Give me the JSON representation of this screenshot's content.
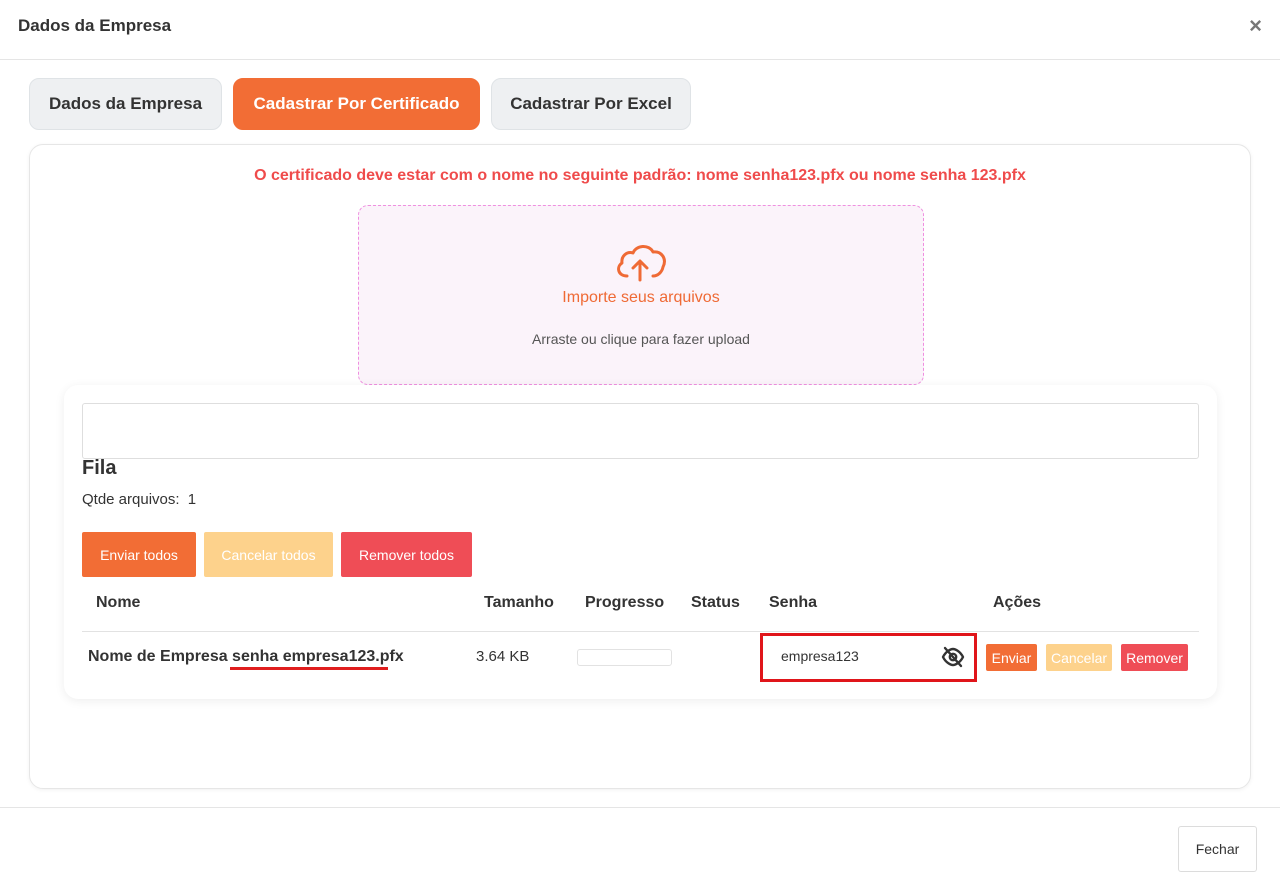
{
  "modal": {
    "title": "Dados da Empresa",
    "close_glyph": "×"
  },
  "tabs": [
    {
      "label": "Dados da Empresa",
      "active": false
    },
    {
      "label": "Cadastrar Por Certificado",
      "active": true
    },
    {
      "label": "Cadastrar Por Excel",
      "active": false
    }
  ],
  "notice": "O certificado deve estar com o nome no seguinte padrão: nome senha123.pfx ou nome senha 123.pfx",
  "dropzone": {
    "icon": "cloud-upload-icon",
    "title": "Importe seus arquivos",
    "subtitle": "Arraste ou clique para fazer upload"
  },
  "queue": {
    "title": "Fila",
    "count_label": "Qtde arquivos:",
    "count": "1",
    "buttons": {
      "send_all": "Enviar todos",
      "cancel_all": "Cancelar todos",
      "remove_all": "Remover todos"
    },
    "columns": [
      "Nome",
      "Tamanho",
      "Progresso",
      "Status",
      "Senha",
      "Ações"
    ],
    "rows": [
      {
        "name": "Nome de Empresa senha empresa123.pfx",
        "size": "3.64 KB",
        "progress": 0,
        "status": "",
        "password": "empresa123",
        "actions": {
          "send": "Enviar",
          "cancel": "Cancelar",
          "remove": "Remover"
        }
      }
    ]
  },
  "footer": {
    "close_label": "Fechar"
  },
  "colors": {
    "accent": "#f26d35",
    "warning": "#fdd28c",
    "danger": "#ef4d56",
    "notice_text": "#ef4b4b",
    "highlight_box": "#e0151a"
  }
}
